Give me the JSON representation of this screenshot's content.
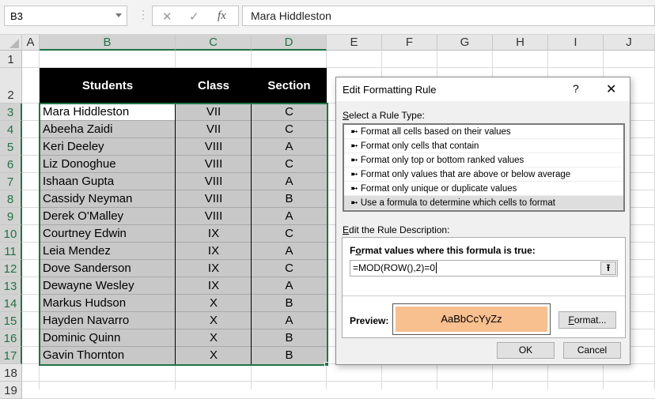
{
  "formula_bar": {
    "name_box": "B3",
    "cancel_icon": "✕",
    "enter_icon": "✓",
    "fx_label": "fx",
    "formula": "Mara Hiddleston"
  },
  "columns": [
    "A",
    "B",
    "C",
    "D",
    "E",
    "F",
    "G",
    "H",
    "I",
    "J"
  ],
  "rows": [
    "1",
    "2",
    "3",
    "4",
    "5",
    "6",
    "7",
    "8",
    "9",
    "10",
    "11",
    "12",
    "13",
    "14",
    "15",
    "16",
    "17",
    "18",
    "19"
  ],
  "table": {
    "headers": [
      "Students",
      "Class",
      "Section"
    ],
    "header_bg": "#000000",
    "fill": "#c8c8c8",
    "selection": "#217346",
    "data": [
      [
        "Mara Hiddleston",
        "VII",
        "C"
      ],
      [
        "Abeeha Zaidi",
        "VII",
        "C"
      ],
      [
        "Keri Deeley",
        "VIII",
        "A"
      ],
      [
        "Liz Donoghue",
        "VIII",
        "C"
      ],
      [
        "Ishaan Gupta",
        "VIII",
        "A"
      ],
      [
        "Cassidy Neyman",
        "VIII",
        "B"
      ],
      [
        "Derek O'Malley",
        "VIII",
        "A"
      ],
      [
        "Courtney Edwin",
        "IX",
        "C"
      ],
      [
        "Leia Mendez",
        "IX",
        "A"
      ],
      [
        "Dove Sanderson",
        "IX",
        "C"
      ],
      [
        "Dewayne Wesley",
        "IX",
        "A"
      ],
      [
        "Markus Hudson",
        "X",
        "B"
      ],
      [
        "Hayden Navarro",
        "X",
        "A"
      ],
      [
        "Dominic Quinn",
        "X",
        "B"
      ],
      [
        "Gavin Thornton",
        "X",
        "B"
      ]
    ]
  },
  "dialog": {
    "title": "Edit Formatting Rule",
    "help": "?",
    "close": "✕",
    "select_label_u": "S",
    "select_label": "elect a Rule Type:",
    "rule_types": [
      "Format all cells based on their values",
      "Format only cells that contain",
      "Format only top or bottom ranked values",
      "Format only values that are above or below average",
      "Format only unique or duplicate values",
      "Use a formula to determine which cells to format"
    ],
    "selected_rule": 5,
    "edit_label_u": "E",
    "edit_label": "dit the Rule Description:",
    "formula_label_pre": "F",
    "formula_label_u": "o",
    "formula_label": "rmat values where this formula is true:",
    "formula": "=MOD(ROW(),2)=0",
    "preview_label": "Preview:",
    "preview_text": "AaBbCcYyZz",
    "preview_color": "#f8bf8f",
    "format_button_u": "F",
    "format_button": "ormat...",
    "ok": "OK",
    "cancel": "Cancel"
  }
}
